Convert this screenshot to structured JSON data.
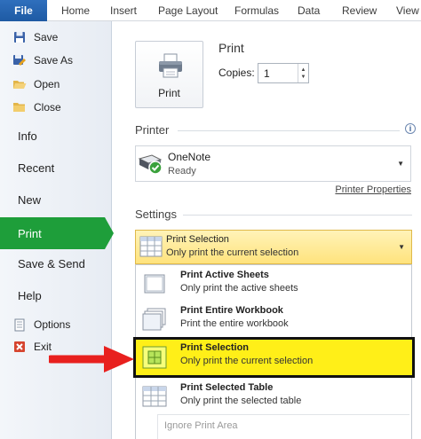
{
  "ribbon": {
    "file": "File",
    "tabs": [
      "Home",
      "Insert",
      "Page Layout",
      "Formulas",
      "Data",
      "Review",
      "View"
    ]
  },
  "sidebar": {
    "save": "Save",
    "save_as": "Save As",
    "open": "Open",
    "close": "Close",
    "info": "Info",
    "recent": "Recent",
    "new": "New",
    "print": "Print",
    "save_send": "Save & Send",
    "help": "Help",
    "options": "Options",
    "exit": "Exit"
  },
  "print": {
    "title": "Print",
    "button_label": "Print",
    "copies_label": "Copies:",
    "copies_value": "1"
  },
  "printer": {
    "heading": "Printer",
    "name": "OneNote",
    "status": "Ready",
    "properties_link": "Printer Properties"
  },
  "settings": {
    "heading": "Settings",
    "selected": {
      "title": "Print Selection",
      "desc": "Only print the current selection"
    },
    "options": [
      {
        "title": "Print Active Sheets",
        "desc": "Only print the active sheets"
      },
      {
        "title": "Print Entire Workbook",
        "desc": "Print the entire workbook"
      },
      {
        "title": "Print Selection",
        "desc": "Only print the current selection"
      },
      {
        "title": "Print Selected Table",
        "desc": "Only print the selected table"
      }
    ],
    "ignore_print_area": "Ignore Print Area"
  },
  "colors": {
    "file_tab": "#1e5aa3",
    "sidebar_selected": "#1e9e3a",
    "selection_highlight": "#ffef18",
    "arrow": "#e8201e"
  }
}
